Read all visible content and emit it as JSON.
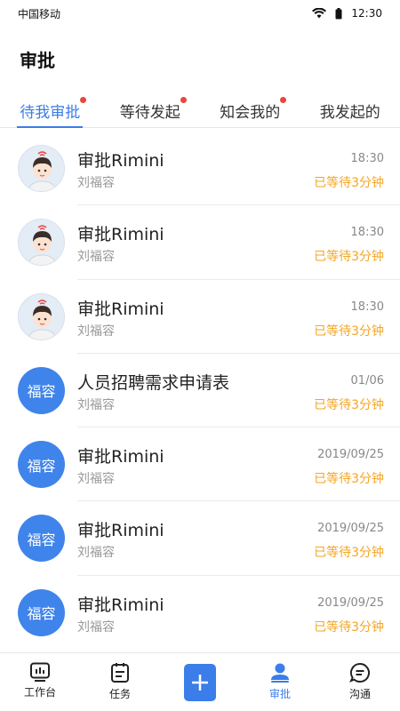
{
  "status": {
    "carrier": "中国移动",
    "time": "12:30"
  },
  "page_title": "审批",
  "tabs": [
    {
      "label": "待我审批",
      "active": true,
      "dot": true
    },
    {
      "label": "等待发起",
      "active": false,
      "dot": true
    },
    {
      "label": "知会我的",
      "active": false,
      "dot": true
    },
    {
      "label": "我发起的",
      "active": false,
      "dot": false
    }
  ],
  "items": [
    {
      "title": "审批Rimini",
      "sub": "刘福容",
      "time": "18:30",
      "wait": "已等待3分钟",
      "avatar": "photo"
    },
    {
      "title": "审批Rimini",
      "sub": "刘福容",
      "time": "18:30",
      "wait": "已等待3分钟",
      "avatar": "photo"
    },
    {
      "title": "审批Rimini",
      "sub": "刘福容",
      "time": "18:30",
      "wait": "已等待3分钟",
      "avatar": "photo"
    },
    {
      "title": "人员招聘需求申请表",
      "sub": "刘福容",
      "time": "01/06",
      "wait": "已等待3分钟",
      "avatar_text": "福容"
    },
    {
      "title": "审批Rimini",
      "sub": "刘福容",
      "time": "2019/09/25",
      "wait": "已等待3分钟",
      "avatar_text": "福容"
    },
    {
      "title": "审批Rimini",
      "sub": "刘福容",
      "time": "2019/09/25",
      "wait": "已等待3分钟",
      "avatar_text": "福容"
    },
    {
      "title": "审批Rimini",
      "sub": "刘福容",
      "time": "2019/09/25",
      "wait": "已等待3分钟",
      "avatar_text": "福容"
    }
  ],
  "nav": [
    {
      "label": "工作台",
      "icon": "dashboard-icon"
    },
    {
      "label": "任务",
      "icon": "task-icon"
    },
    {
      "label": "",
      "icon": "plus-icon"
    },
    {
      "label": "审批",
      "icon": "approval-icon",
      "active": true
    },
    {
      "label": "沟通",
      "icon": "chat-icon"
    }
  ],
  "colors": {
    "accent": "#3b7de9",
    "wait": "#f5a623",
    "dot": "#e8463f"
  }
}
